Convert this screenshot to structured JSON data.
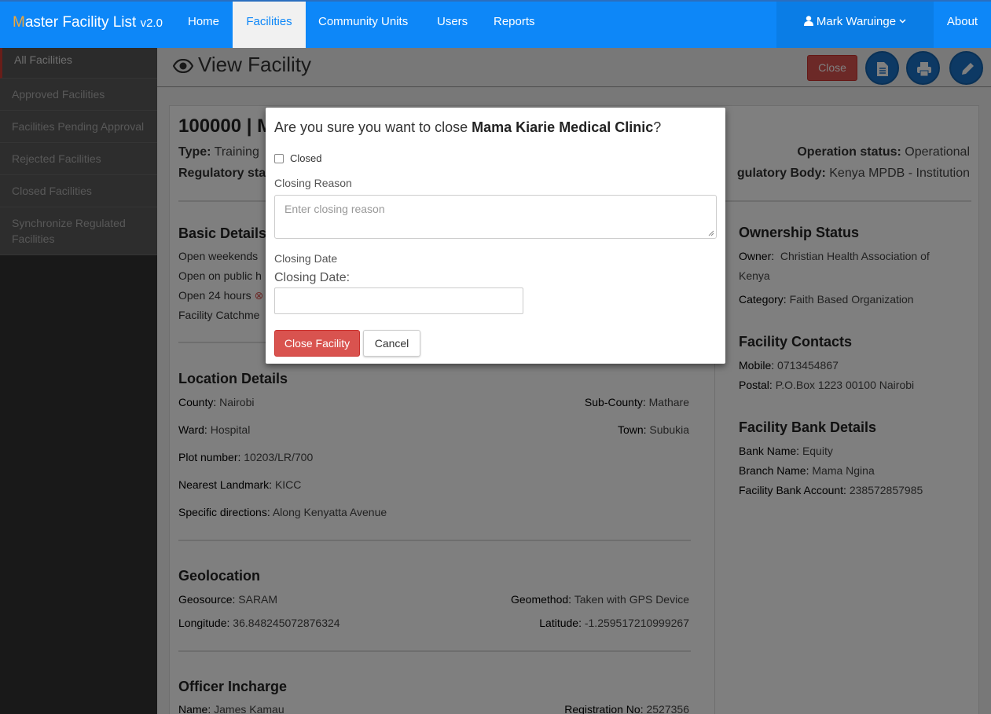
{
  "navbar": {
    "brand_first_letter": "M",
    "brand_rest": "aster Facility List",
    "brand_version": "v2.0",
    "items": [
      "Home",
      "Facilities",
      "Community Units",
      "Users",
      "Reports"
    ],
    "active_item": "Facilities",
    "user_name": "Mark Waruinge",
    "about": "About"
  },
  "sidebar": {
    "items": [
      {
        "label": "All Facilities"
      },
      {
        "label": "Approved Facilities"
      },
      {
        "label": "Facilities Pending Approval"
      },
      {
        "label": "Rejected Facilities"
      },
      {
        "label": "Closed Facilities"
      },
      {
        "label": "Synchronize Regulated Facilities"
      }
    ]
  },
  "header": {
    "title": "View Facility",
    "close_button": "Close"
  },
  "facility": {
    "code_name": "100000 | M",
    "type_label": "Type:",
    "type_value": "Training",
    "regulatory_status_label": "Regulatory sta",
    "operation_status_label": "Operation status:",
    "operation_status_value": "Operational",
    "regulatory_body_label": "gulatory Body:",
    "regulatory_body_value": "Kenya MPDB - Institution"
  },
  "basic_details": {
    "heading": "Basic Details",
    "open_weekends": "Open weekends",
    "open_public_holidays": "Open on public h",
    "open_24_hours": "Open 24 hours",
    "catchment": "Facility Catchme"
  },
  "location_details": {
    "heading": "Location Details",
    "county_label": "County:",
    "county_value": "Nairobi",
    "subcounty_label": "Sub-County:",
    "subcounty_value": "Mathare",
    "ward_label": "Ward:",
    "ward_value": "Hospital",
    "town_label": "Town:",
    "town_value": "Subukia",
    "plot_label": "Plot number:",
    "plot_value": "10203/LR/700",
    "landmark_label": "Nearest Landmark:",
    "landmark_value": "KICC",
    "directions_label": "Specific directions:",
    "directions_value": "Along Kenyatta Avenue"
  },
  "geolocation": {
    "heading": "Geolocation",
    "geosource_label": "Geosource:",
    "geosource_value": "SARAM",
    "geomethod_label": "Geomethod:",
    "geomethod_value": "Taken with GPS Device",
    "longitude_label": "Longitude:",
    "longitude_value": "36.848245072876324",
    "latitude_label": "Latitude:",
    "latitude_value": "-1.259517210999267"
  },
  "officer": {
    "heading": "Officer Incharge",
    "name_label": "Name:",
    "name_value": "James Kamau",
    "reg_label": "Registration No:",
    "reg_value": "2527356"
  },
  "ownership": {
    "heading": "Ownership Status",
    "owner_label": "Owner:",
    "owner_value_line1": "Christian Health Association of",
    "owner_value_line2": "Kenya",
    "category_label": "Category:",
    "category_value": "Faith Based Organization"
  },
  "contacts": {
    "heading": "Facility Contacts",
    "mobile_label": "Mobile:",
    "mobile_value": "0713454867",
    "postal_label": "Postal:",
    "postal_value": "P.O.Box 1223 00100 Nairobi"
  },
  "bank": {
    "heading": "Facility Bank Details",
    "bank_label": "Bank Name:",
    "bank_value": "Equity",
    "branch_label": "Branch Name:",
    "branch_value": "Mama Ngina",
    "account_label": "Facility Bank Account:",
    "account_value": "238572857985"
  },
  "modal": {
    "title_prefix": "Are you sure you want to close ",
    "facility_name": "Mama Kiarie Medical Clinic",
    "title_suffix": "?",
    "checkbox_label": "Closed",
    "closing_reason_label": "Closing Reason",
    "closing_reason_placeholder": "Enter closing reason",
    "closing_date_label": "Closing Date",
    "closing_date_inner_label": "Closing Date:",
    "close_facility_button": "Close Facility",
    "cancel_button": "Cancel"
  },
  "colors": {
    "navbar": "#0d87f8",
    "danger": "#d9534f",
    "sidebar": "#333333",
    "brand_accent": "#f0a73b"
  }
}
